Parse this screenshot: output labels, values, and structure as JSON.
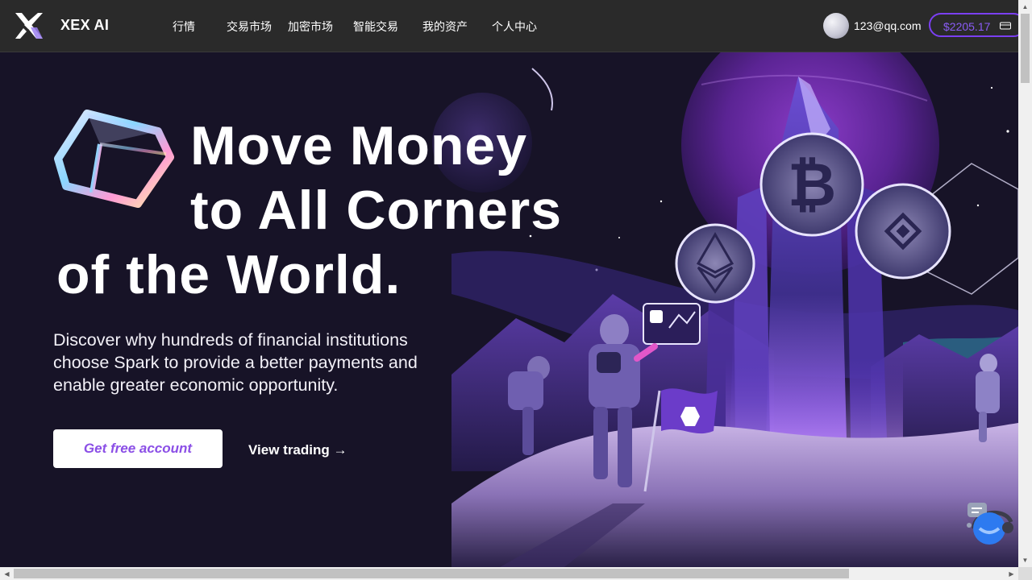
{
  "header": {
    "logo_text": "XEX AI",
    "nav": [
      "行情",
      "交易市场",
      "加密市场",
      "智能交易",
      "我的资产",
      "个人中心"
    ],
    "user_email": "123@qq.com",
    "balance": "$2205.17",
    "accent_color": "#7b3ff2"
  },
  "hero": {
    "headline_lines": [
      "Move Money",
      "to All Corners",
      "of the World."
    ],
    "subtext": "Discover why hundreds of financial institutions choose Spark to provide a better payments and enable greater economic opportunity.",
    "cta_primary": "Get free account",
    "cta_secondary": "View trading →",
    "illustration_icons": [
      "bitcoin-icon",
      "ethereum-icon",
      "binance-icon"
    ]
  },
  "icons": {
    "logo": "x-logo-icon",
    "wallet": "wallet-icon",
    "support": "headset-chat-icon",
    "decor": "glass-cube-icon"
  }
}
